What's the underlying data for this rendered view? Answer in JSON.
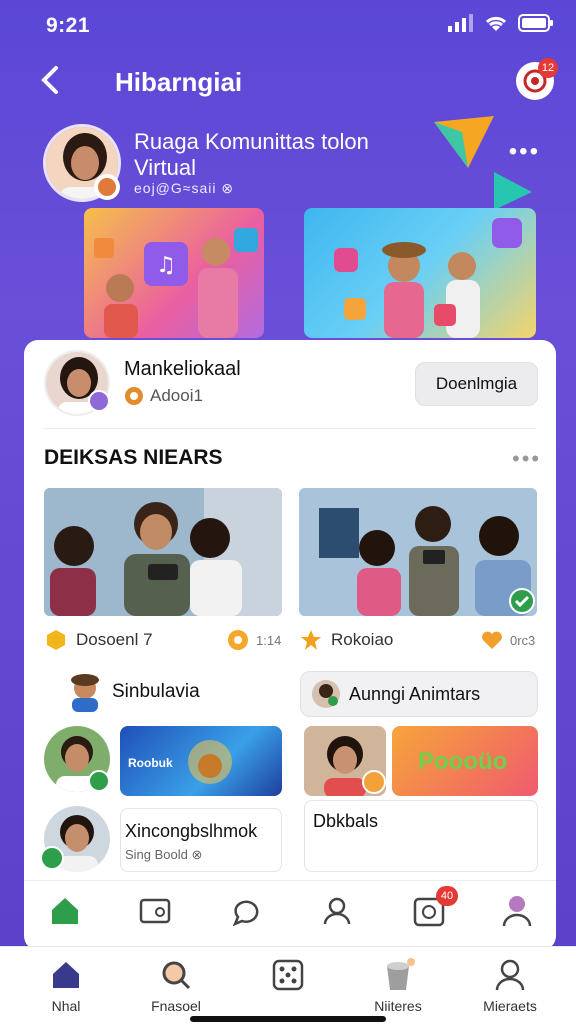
{
  "status": {
    "time": "9:21"
  },
  "header": {
    "title": "Hibarngiai",
    "notification_count": "12"
  },
  "room": {
    "title": "Ruaga Komunittas tolon Virtual",
    "subtitle": "eoj@G≈saii ⊗"
  },
  "host": {
    "name": "Mankeliokaal",
    "role": "Adooi1",
    "action_label": "Doenlmgia"
  },
  "section": {
    "title": "DEIKSAS NIEARS"
  },
  "photos": [
    {
      "label": "Dosoenl 7",
      "meta": "1:14"
    },
    {
      "label": "Rokoiao",
      "meta": "0rc3"
    }
  ],
  "chips": [
    {
      "label": "Sinbulavia"
    },
    {
      "label": "Aunngi Animtars"
    }
  ],
  "promos": [
    {
      "text": "Roobuk"
    },
    {
      "text": "Poooüo"
    }
  ],
  "users": [
    {
      "name": "Xincongbslhmok",
      "sub": "Sing Boold ⊗"
    },
    {
      "name": "Dbkbals"
    }
  ],
  "inner_nav": {
    "badge": "40"
  },
  "bottom_tabs": [
    {
      "label": "Nhal"
    },
    {
      "label": "Fnasoel"
    },
    {
      "label": ""
    },
    {
      "label": "Niiteres"
    },
    {
      "label": "Mieraets"
    }
  ],
  "colors": {
    "accent": "#5b47d6",
    "green": "#2e9e4b",
    "badge": "#e53935"
  }
}
